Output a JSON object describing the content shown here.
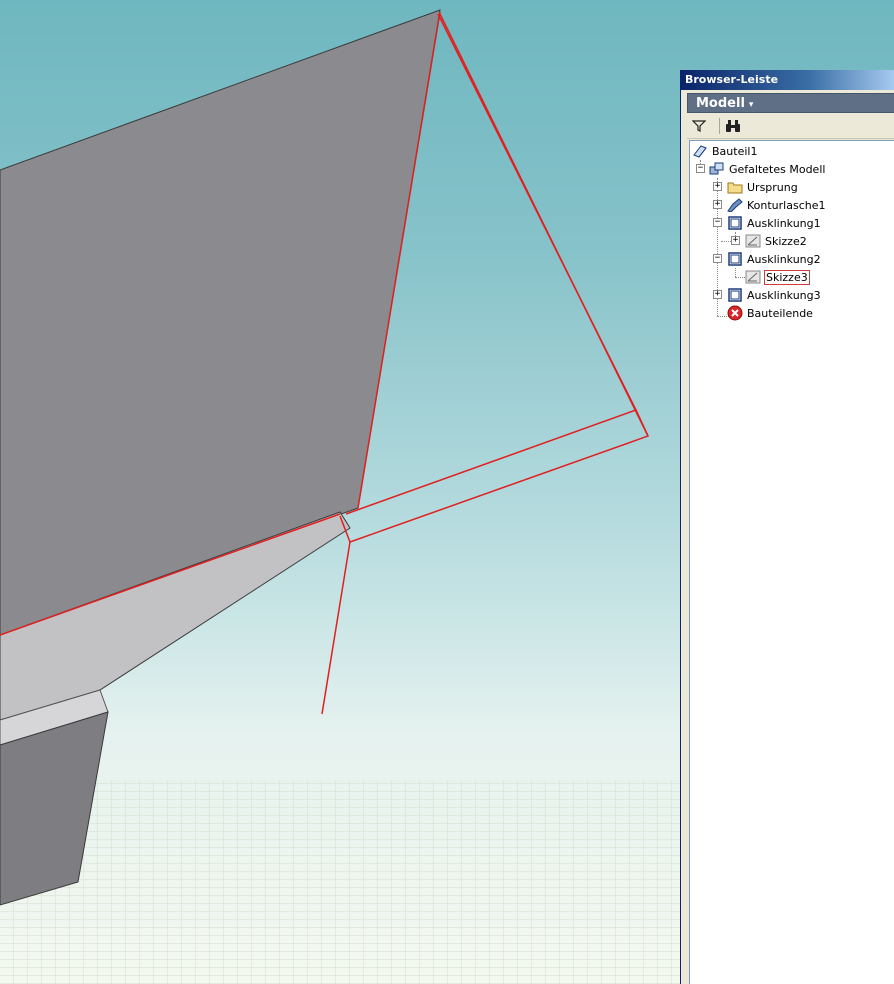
{
  "browser": {
    "title": "Browser-Leiste",
    "dropdown": {
      "label": "Modell",
      "caret": "▾"
    },
    "toolbar": {
      "filter_icon": "filter-icon",
      "find_icon": "binoculars-icon"
    },
    "tree": {
      "root": "Bauteil1",
      "items": [
        {
          "label": "Gefaltetes Modell",
          "icon": "folded-model-icon"
        },
        {
          "label": "Ursprung",
          "icon": "folder-icon"
        },
        {
          "label": "Konturlasche1",
          "icon": "contour-flange-icon"
        },
        {
          "label": "Ausklinkung1",
          "icon": "cut-icon"
        },
        {
          "label": "Skizze2",
          "icon": "sketch-icon"
        },
        {
          "label": "Ausklinkung2",
          "icon": "cut-icon"
        },
        {
          "label": "Skizze3",
          "icon": "sketch-icon",
          "selected": true
        },
        {
          "label": "Ausklinkung3",
          "icon": "cut-icon"
        },
        {
          "label": "Bauteilende",
          "icon": "end-of-part-icon"
        }
      ]
    }
  },
  "colors": {
    "highlight": "#e02020",
    "sheet_dark": "#8a8a8e",
    "sheet_light": "#b8b8ba"
  }
}
